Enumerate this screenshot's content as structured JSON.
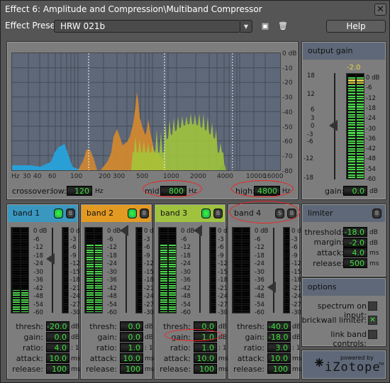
{
  "window": {
    "title": "Effect 6: Amplitude and Compression\\Multiband Compressor",
    "close_icon": "close-icon"
  },
  "preset": {
    "label": "Effect Preset:",
    "value": "HRW 021b",
    "save_icon": "save-icon",
    "delete_icon": "delete-icon",
    "help_label": "Help"
  },
  "spectrum": {
    "db_ticks": [
      "0 dB",
      "-10",
      "-20",
      "-30",
      "-40",
      "-50",
      "-60",
      "-70",
      "-80"
    ],
    "hz_ticks": [
      "Hz",
      "30",
      "40",
      "60",
      "100",
      "200",
      "300",
      "500",
      "1000",
      "2000",
      "4000",
      "10000",
      "16000"
    ],
    "crossover_label": "crossover:",
    "low_label": "low:",
    "low_value": "120",
    "low_unit": "Hz",
    "mid_label": "mid:",
    "mid_value": "800",
    "mid_unit": "Hz",
    "high_label": "high:",
    "high_value": "4800",
    "high_unit": "Hz",
    "band_colors": [
      "#2a9fd6",
      "#d7892c",
      "#a3c93a",
      "#8ab840"
    ]
  },
  "output_gain": {
    "title": "output gain",
    "peak": "-2.0",
    "slider_ticks": [
      "18",
      "12",
      "6",
      "3",
      "0",
      "-3",
      "-6",
      "-12",
      "-18"
    ],
    "meter_ticks": [
      "0 dB",
      "-6",
      "-12",
      "-18",
      "-24",
      "-30",
      "-36",
      "-42",
      "-48",
      "-54",
      "-60"
    ],
    "gain_label": "gain:",
    "gain_value": "0.0",
    "gain_unit": "dB",
    "slider_db": 0,
    "meter_level_db": -2.0
  },
  "bands": [
    {
      "name": "band 1",
      "color": "#3a98c0",
      "solo": true,
      "thresh": "-20.0",
      "gain": "0.0",
      "ratio": "4.0",
      "attack": "10.0",
      "release": "100",
      "slider_db": -20,
      "meter_db": -44
    },
    {
      "name": "band 2",
      "color": "#e39a22",
      "solo": true,
      "thresh": "0.0",
      "gain": "0.0",
      "ratio": "1.0",
      "attack": "10.0",
      "release": "100",
      "slider_db": 0,
      "meter_db": -12
    },
    {
      "name": "band 3",
      "color": "#9fc23f",
      "solo": true,
      "thresh": "0.0",
      "gain": "1.0",
      "ratio": "1.0",
      "attack": "10.0",
      "release": "100",
      "slider_db": 0,
      "meter_db": -12
    },
    {
      "name": "band 4",
      "color": "#7a7a7a",
      "solo": false,
      "thresh": "-40.0",
      "gain": "-18.0",
      "ratio": "3.0",
      "attack": "10.0",
      "release": "100",
      "slider_db": -40,
      "meter_db": -60
    }
  ],
  "band_labels": {
    "thresh": "thresh:",
    "gain": "gain:",
    "ratio": "ratio:",
    "attack": "attack:",
    "release": "release:",
    "db": "dB",
    "ratio_unit": ": 1",
    "ms": "ms",
    "solo": "S",
    "bypass": "B"
  },
  "band_meter_ticks": [
    "0 dB",
    "-6",
    "-12",
    "-18",
    "-24",
    "-30",
    "-36",
    "-42",
    "-48",
    "-54",
    "-60"
  ],
  "band_gr_ticks": [
    "0 dB",
    "-3",
    "-6",
    "-9",
    "-12",
    "-15",
    "-18",
    "-21",
    "-24",
    "-27",
    "-30"
  ],
  "limiter": {
    "title": "limiter",
    "bypass": "B",
    "threshold_label": "threshold:",
    "threshold": "-18.0",
    "margin_label": "margin:",
    "margin": "-2.0",
    "attack_label": "attack:",
    "attack": "4.0",
    "release_label": "release:",
    "release": "500",
    "db": "dB",
    "ms": "ms"
  },
  "options": {
    "title": "options",
    "spectrum_on_input": "spectrum on input:",
    "brickwall_limiter": "brickwall limiter:",
    "link_band_controls": "link band controls:",
    "spectrum_checked": false,
    "brickwall_checked": true,
    "link_checked": false,
    "check_mark": "✕"
  },
  "logo": {
    "powered_by": "powered by",
    "brand": "iZotope",
    "tm": "TM"
  }
}
